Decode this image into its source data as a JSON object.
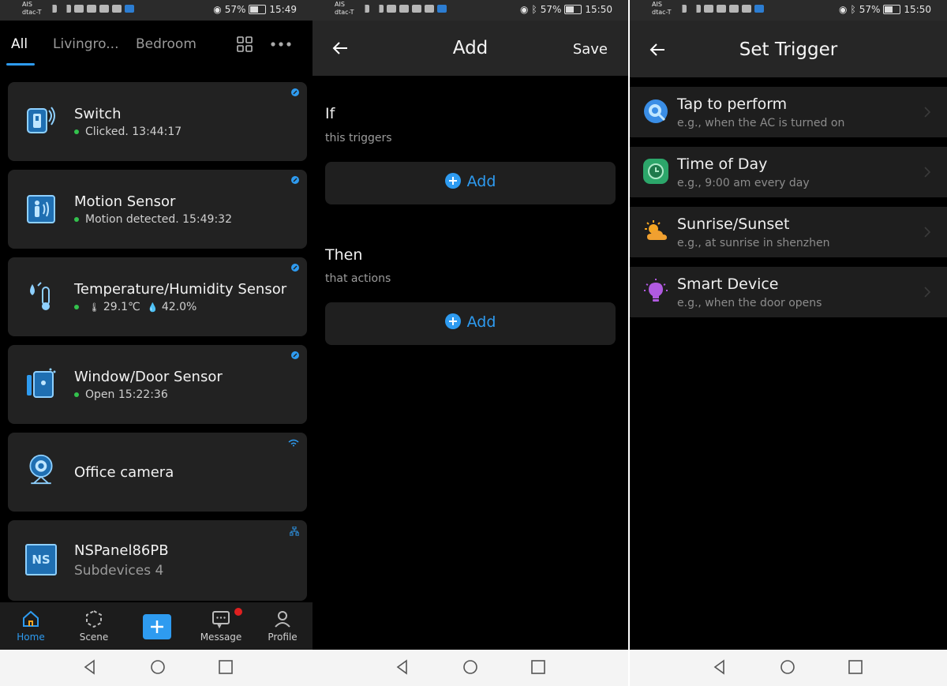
{
  "status_bars": [
    {
      "carrier_top": "AIS",
      "carrier_bottom": "dtac-T",
      "battery": "57%",
      "time": "15:49"
    },
    {
      "carrier_top": "AIS",
      "carrier_bottom": "dtac-T",
      "battery": "57%",
      "time": "15:50"
    },
    {
      "carrier_top": "AIS",
      "carrier_bottom": "dtac-T",
      "battery": "57%",
      "time": "15:50"
    }
  ],
  "home": {
    "tabs": [
      "All",
      "Livingro...",
      "Bedroom"
    ],
    "devices": [
      {
        "name": "Switch",
        "status": "Clicked. 13:44:17"
      },
      {
        "name": "Motion Sensor",
        "status": "Motion detected. 15:49:32"
      },
      {
        "name": "Temperature/Humidity Sensor",
        "temperature": "29.1℃",
        "humidity": "42.0%"
      },
      {
        "name": "Window/Door Sensor",
        "status": "Open 15:22:36"
      },
      {
        "name": "Office camera"
      },
      {
        "name": "NSPanel86PB",
        "subdevices_label": "Subdevices",
        "subdevices_count": "4",
        "icon_text": "NS"
      }
    ],
    "bottom_tabs": [
      "Home",
      "Scene",
      "Message",
      "Profile"
    ],
    "accent": "#2e9bf0"
  },
  "add_scene": {
    "title": "Add",
    "save_label": "Save",
    "if_title": "If",
    "if_sub": "this triggers",
    "then_title": "Then",
    "then_sub": "that actions",
    "add_label": "Add"
  },
  "set_trigger": {
    "title": "Set Trigger",
    "items": [
      {
        "name": "Tap to perform",
        "desc": "e.g., when the AC is turned on",
        "icon": "tap-icon"
      },
      {
        "name": "Time of Day",
        "desc": "e.g., 9:00 am every day",
        "icon": "clock-icon"
      },
      {
        "name": "Sunrise/Sunset",
        "desc": "e.g., at sunrise in shenzhen",
        "icon": "sun-cloud-icon"
      },
      {
        "name": "Smart Device",
        "desc": "e.g., when the door opens",
        "icon": "bulb-icon"
      }
    ]
  }
}
